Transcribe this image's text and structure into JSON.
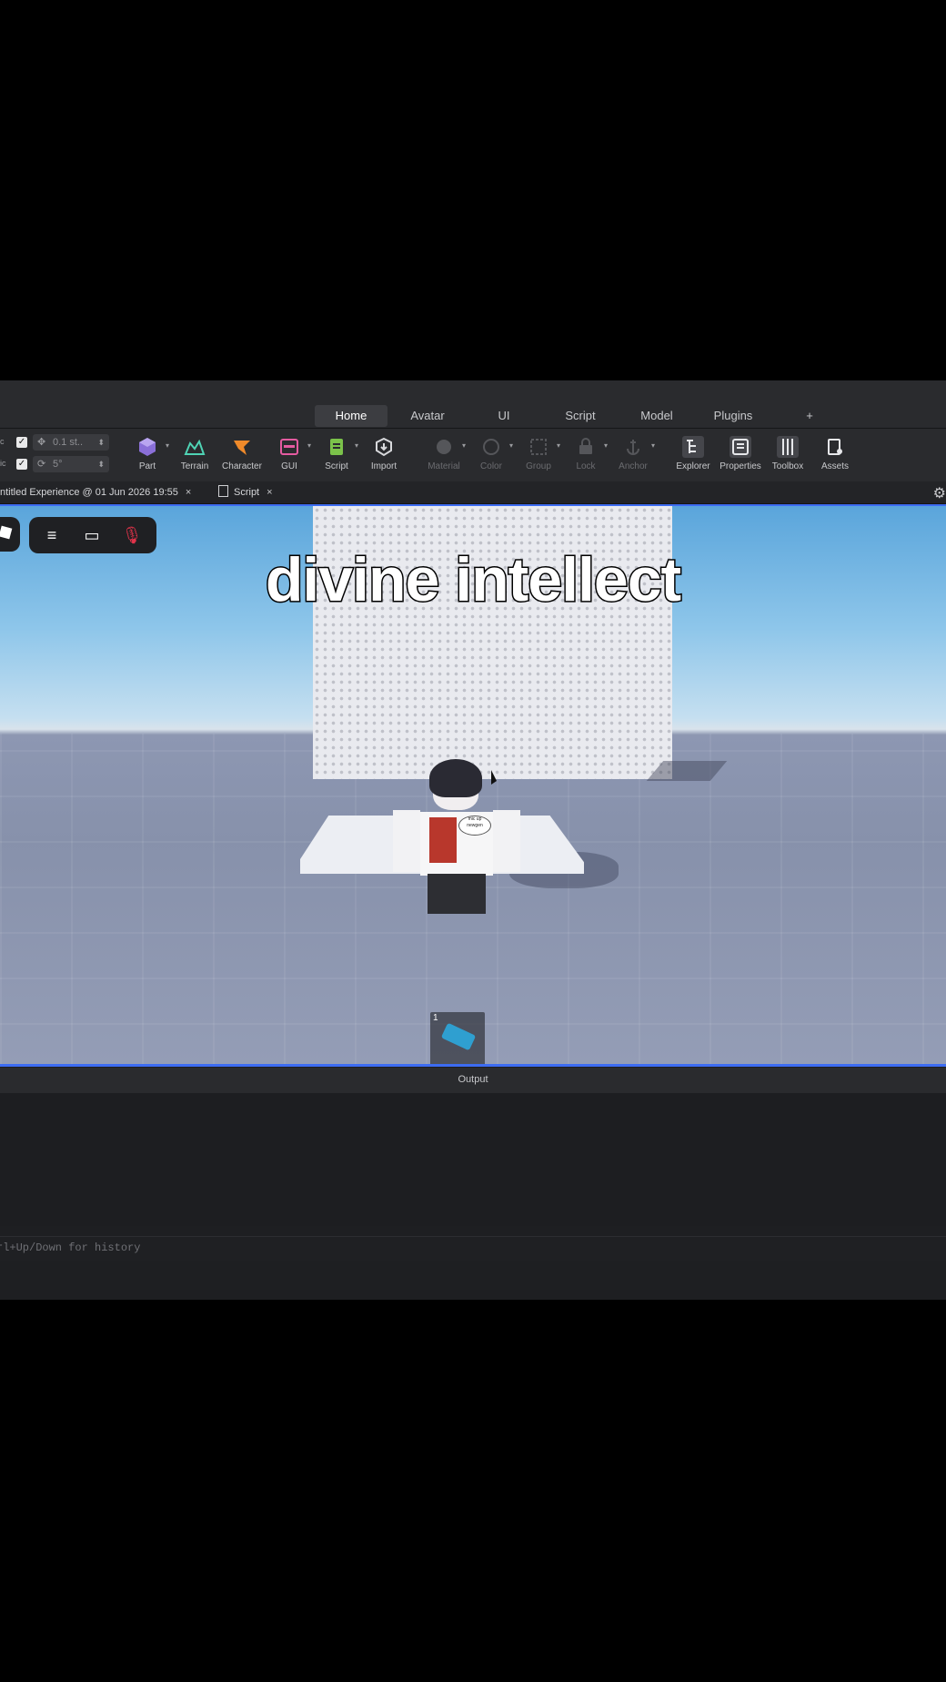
{
  "menubar": {
    "tabs": [
      {
        "label": "Home",
        "active": true
      },
      {
        "label": "Avatar"
      },
      {
        "label": "UI"
      },
      {
        "label": "Script"
      },
      {
        "label": "Model"
      },
      {
        "label": "Plugins"
      },
      {
        "label": "+"
      }
    ]
  },
  "toolbar": {
    "snap_move": {
      "value": "0.1 st..",
      "checked": true,
      "prefix": "c"
    },
    "snap_rotate": {
      "value": "5°",
      "checked": true,
      "prefix": "ic"
    },
    "tools": [
      {
        "label": "Part",
        "icon": "part-icon"
      },
      {
        "label": "Terrain",
        "icon": "terrain-icon"
      },
      {
        "label": "Character",
        "icon": "character-icon"
      },
      {
        "label": "GUI",
        "icon": "gui-icon"
      },
      {
        "label": "Script",
        "icon": "script-icon"
      },
      {
        "label": "Import",
        "icon": "import-icon"
      },
      {
        "label": "Material",
        "icon": "material-icon",
        "disabled": true
      },
      {
        "label": "Color",
        "icon": "color-icon",
        "disabled": true
      },
      {
        "label": "Group",
        "icon": "group-icon",
        "disabled": true
      },
      {
        "label": "Lock",
        "icon": "lock-icon",
        "disabled": true
      },
      {
        "label": "Anchor",
        "icon": "anchor-icon",
        "disabled": true
      },
      {
        "label": "Explorer",
        "icon": "explorer-icon"
      },
      {
        "label": "Properties",
        "icon": "properties-icon"
      },
      {
        "label": "Toolbox",
        "icon": "toolbox-icon"
      },
      {
        "label": "Assets",
        "icon": "assets-icon"
      }
    ]
  },
  "docbar": {
    "tab1": "ntitled Experience @ 01 Jun 2026 19:55",
    "tab2": "Script",
    "close": "×"
  },
  "viewport": {
    "caption": "divine intellect",
    "hotbar_slot": "1",
    "speech_bubble": "mic up\nnewgen"
  },
  "output": {
    "title": "Output",
    "command_placeholder": "rl+Up/Down for history"
  },
  "colors": {
    "accent": "#3d6cf2",
    "panel": "#2a2b2e",
    "background": "#000000"
  }
}
